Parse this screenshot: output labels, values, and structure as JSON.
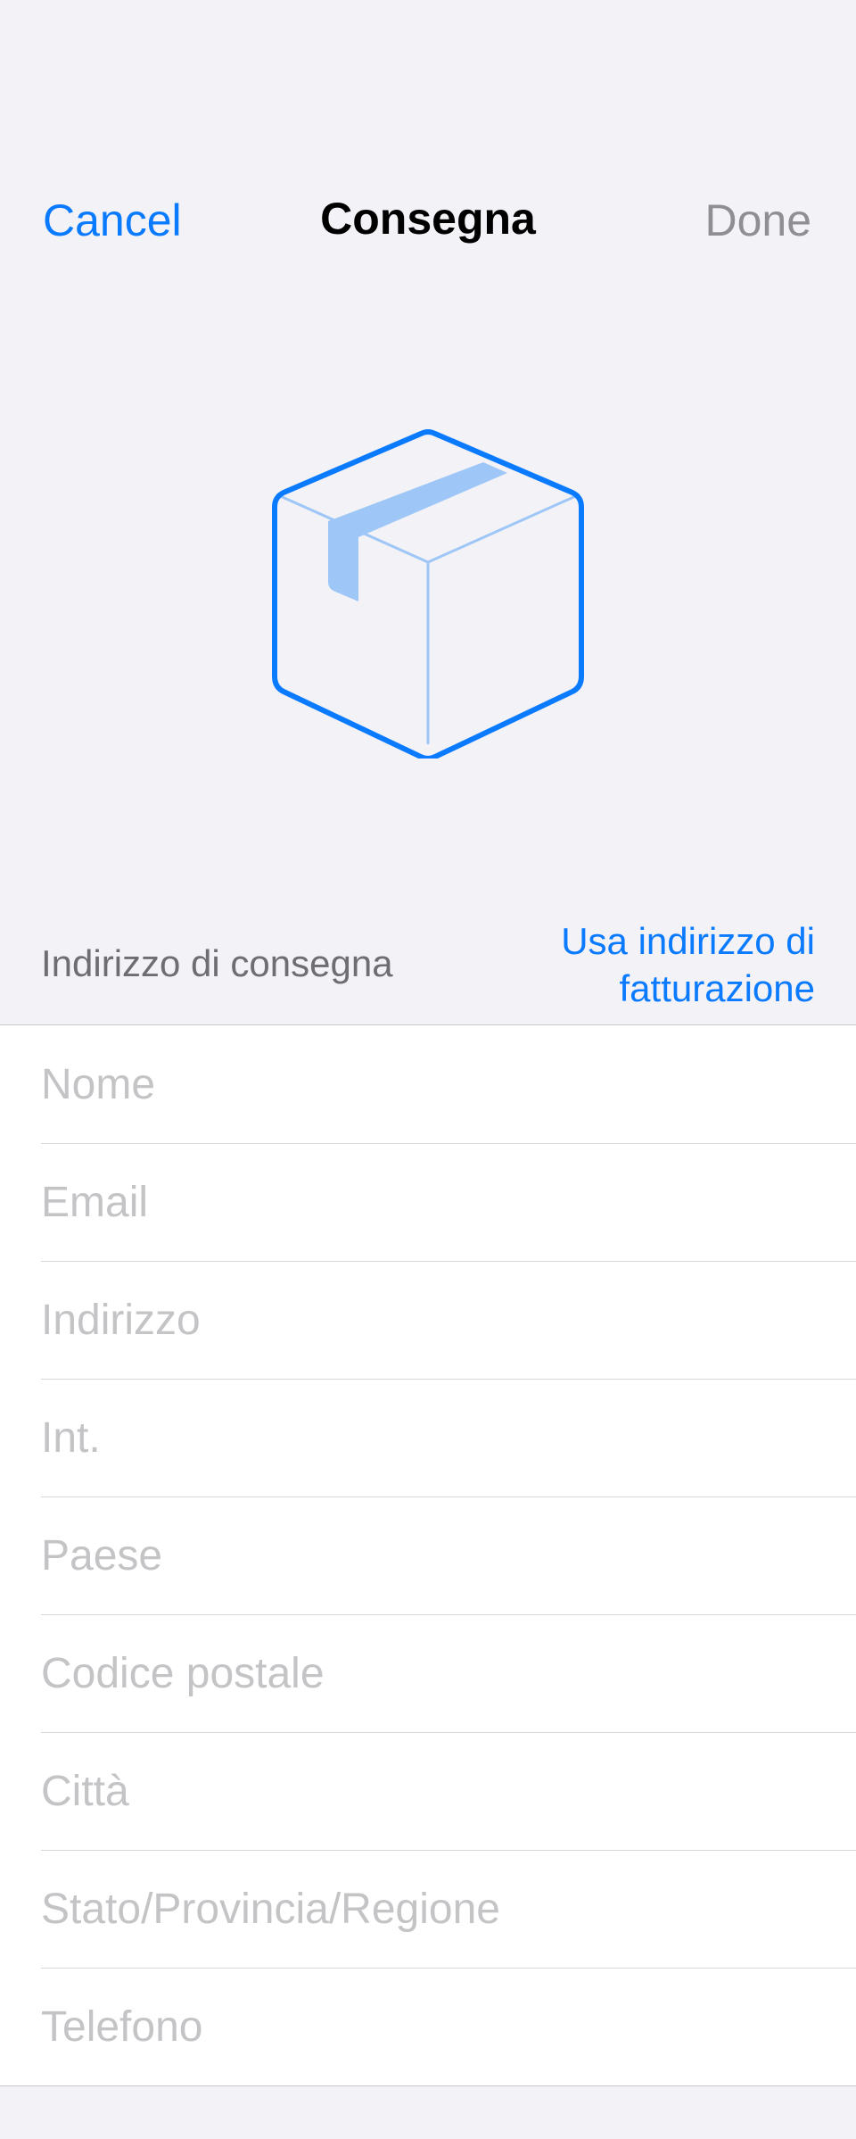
{
  "nav": {
    "cancel_label": "Cancel",
    "title": "Consegna",
    "done_label": "Done"
  },
  "illustration": {
    "icon": "package-box-icon",
    "stroke_color": "#0a7aff",
    "inner_line_color": "#9ec7f7",
    "tape_color": "#9ec7f7"
  },
  "section": {
    "label": "Indirizzo di consegna",
    "action_line1": "Usa indirizzo di",
    "action_line2": "fatturazione"
  },
  "fields": [
    {
      "placeholder": "Nome",
      "value": ""
    },
    {
      "placeholder": "Email",
      "value": ""
    },
    {
      "placeholder": "Indirizzo",
      "value": ""
    },
    {
      "placeholder": "Int.",
      "value": ""
    },
    {
      "placeholder": "Paese",
      "value": ""
    },
    {
      "placeholder": "Codice postale",
      "value": ""
    },
    {
      "placeholder": "Città",
      "value": ""
    },
    {
      "placeholder": "Stato/Provincia/Regione",
      "value": ""
    },
    {
      "placeholder": "Telefono",
      "value": ""
    }
  ],
  "colors": {
    "accent": "#0a7aff",
    "background": "#f2f2f7",
    "disabled_text": "#8e8e93",
    "placeholder": "#c4c4c7"
  }
}
